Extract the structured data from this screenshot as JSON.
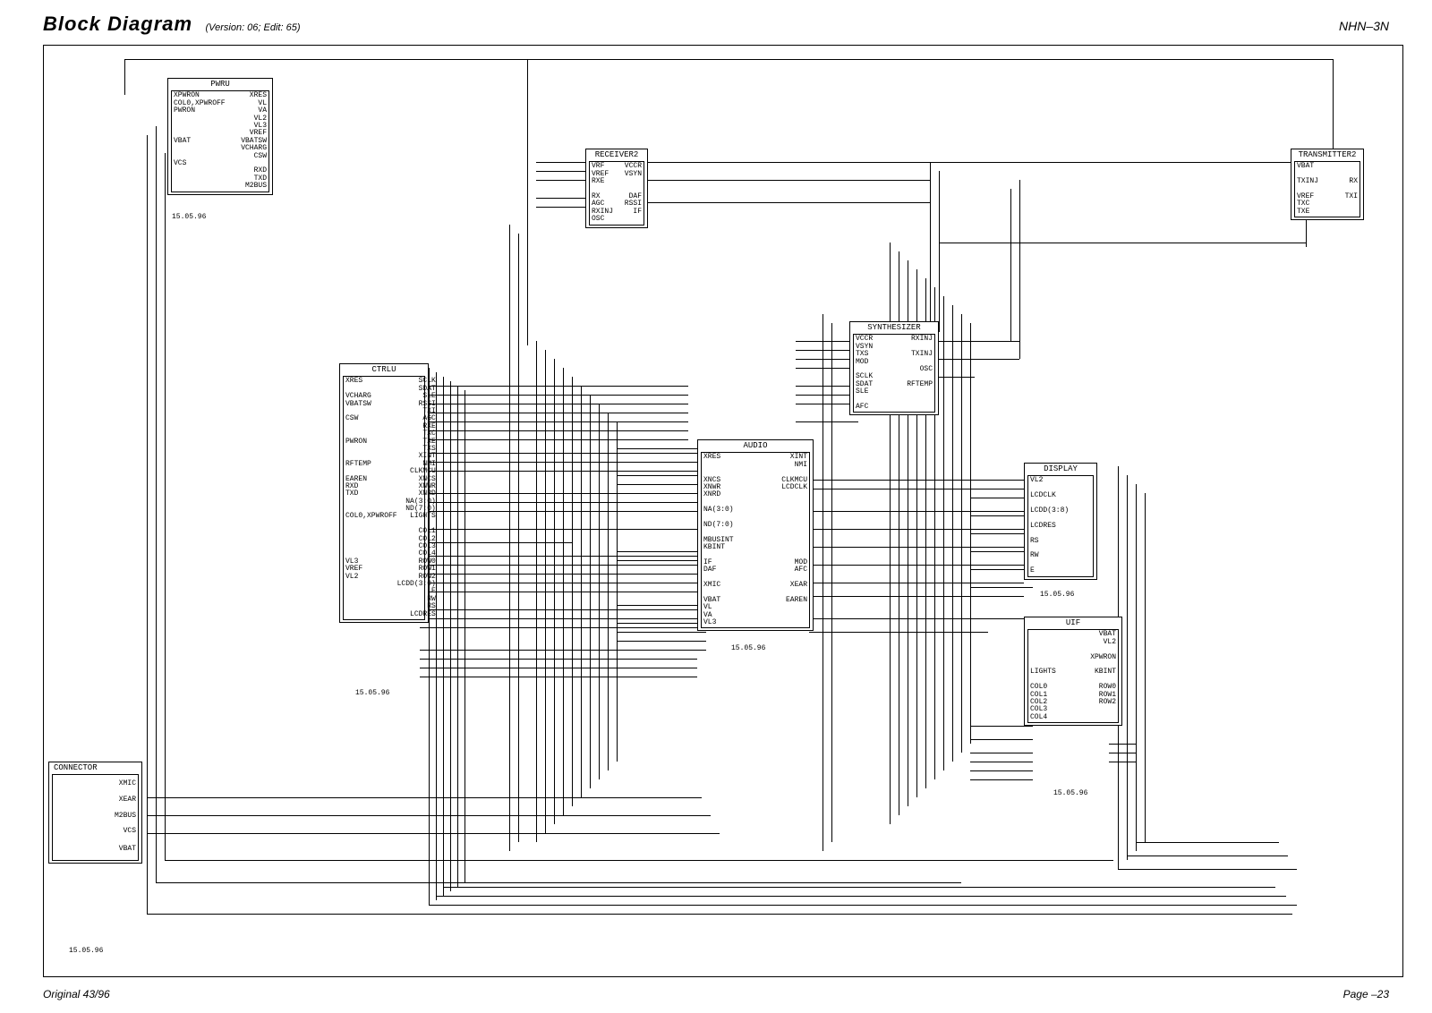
{
  "header": {
    "title": "Block Diagram",
    "version": "(Version: 06; Edit: 65)",
    "part": "NHN–3N"
  },
  "footer": {
    "left": "Original 43/96",
    "right": "Page  –23"
  },
  "dates": {
    "pwru": "15.05.96",
    "ctrlu": "15.05.96",
    "audio": "15.05.96",
    "display": "15.05.96",
    "uif": "15.05.96",
    "connector": "15.05.96"
  },
  "blocks": {
    "pwru": {
      "title": "PWRU",
      "left": "XPWRON\nCOL0,XPWROFF\nPWRON\n\n\n\nVBAT\n\n\nVCS",
      "right": "XRES\nVL\nVA\nVL2\nVL3\nVREF\nVBATSW\nVCHARG\nCSW\n\nRXD\nTXD\nM2BUS"
    },
    "ctrlu": {
      "title": "CTRLU",
      "left": "XRES\n\nVCHARG\nVBATSW\n\nCSW\n\n\nPWRON\n\n\nRFTEMP\n\nEAREN\nRXD\nTXD\n\n\nCOL0,XPWROFF\n\n\n\n\n\nVL3\nVREF\nVL2",
      "right": "SCLK\nSDAT\nSLE\nRSSI\nTXI\nAGC\nRXE\nTXC\nTXE\nTXS\nXINT\nNMI\nCLKMCU\nXNCS\nXNWR\nXNRD\nNA(3:0)\nND(7:0)\nLIGHTS\n\nCOL1\nCOL2\nCOL3\nCOL4\nROW0\nROW1\nROW2\nLCDD(3:0)\nE\nRW\nRS\nLCDRES"
    },
    "receiver2": {
      "title": "RECEIVER2",
      "left": "VRF\nVREF\nRXE\n\nRX\nAGC\nRXINJ\nOSC",
      "right": "VCCR\nVSYN\n\n\nDAF\nRSSI\nIF"
    },
    "transmitter2": {
      "title": "TRANSMITTER2",
      "left": "VBAT\n\nTXINJ\n\nVREF\nTXC\nTXE",
      "right": "\n\nRX\n\nTXI"
    },
    "synthesizer": {
      "title": "SYNTHESIZER",
      "left": "VCCR\nVSYN\nTXS\nMOD\n\nSCLK\nSDAT\nSLE\n\nAFC",
      "right": "RXINJ\n\nTXINJ\n\nOSC\n\nRFTEMP"
    },
    "audio": {
      "title": "AUDIO",
      "left": "XRES\n\n\nXNCS\nXNWR\nXNRD\n\nNA(3:0)\n\nND(7:0)\n\nMBUSINT\nKBINT\n\nIF\nDAF\n\nXMIC\n\nVBAT\nVL\nVA\nVL3",
      "right": "XINT\nNMI\n\nCLKMCU\nLCDCLK\n\n\n\n\n\n\n\n\n\nMOD\nAFC\n\nXEAR\n\nEAREN"
    },
    "display": {
      "title": "DISPLAY",
      "left": "VL2\n\nLCDCLK\n\nLCDD(3:8)\n\nLCDRES\n\nRS\n\nRW\n\nE"
    },
    "uif": {
      "title": "UIF",
      "left": "\n\n\n\n\nLIGHTS\n\nCOL0\nCOL1\nCOL2\nCOL3\nCOL4",
      "right": "VBAT\nVL2\n\nXPWRON\n\nKBINT\n\nROW0\nROW1\nROW2"
    },
    "connector": {
      "title": "CONNECTOR",
      "labels": [
        "XMIC",
        "XEAR",
        "M2BUS",
        "VCS",
        "VBAT"
      ]
    }
  }
}
